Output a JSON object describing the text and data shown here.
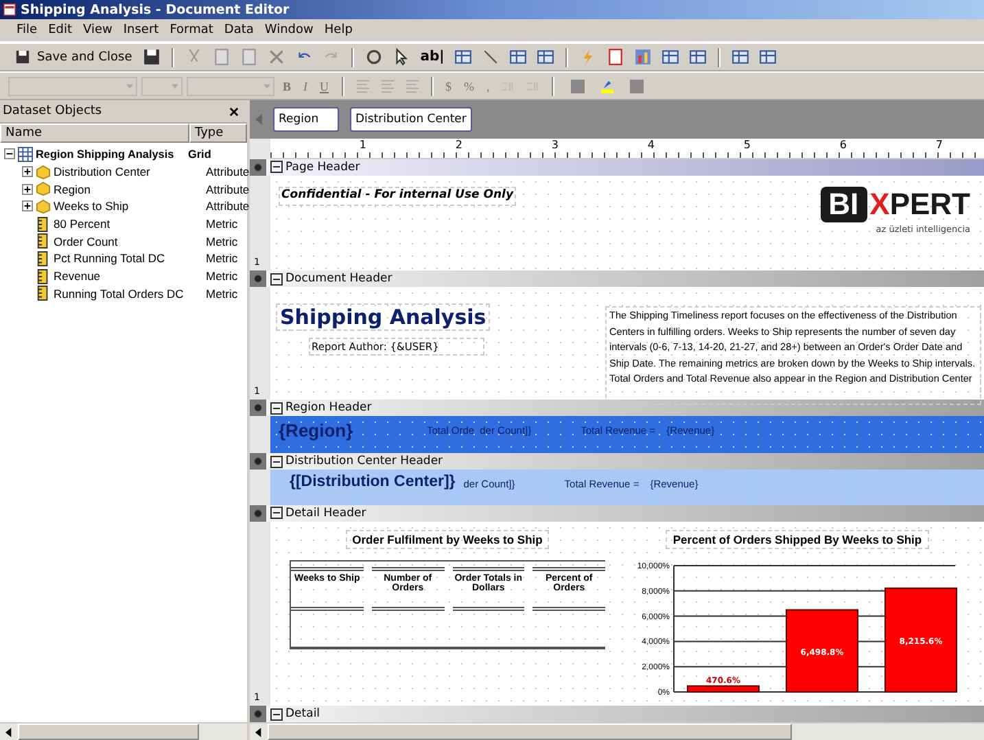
{
  "window": {
    "title": "Shipping Analysis - Document Editor"
  },
  "menu": [
    "File",
    "Edit",
    "View",
    "Insert",
    "Format",
    "Data",
    "Window",
    "Help"
  ],
  "toolbar": {
    "save_close": "Save and Close",
    "textbox_tool": "ab|",
    "font_buttons": [
      "B",
      "I",
      "U"
    ],
    "number_buttons": [
      "$",
      "%",
      ","
    ]
  },
  "dataset_panel": {
    "title": "Dataset Objects",
    "columns": [
      "Name",
      "Type"
    ],
    "items": [
      {
        "name": "Region Shipping Analysis",
        "type": "Grid",
        "kind": "grid",
        "expanded": true,
        "children": [
          {
            "name": "Distribution Center",
            "type": "Attribute",
            "kind": "attribute",
            "expanded": false
          },
          {
            "name": "Region",
            "type": "Attribute",
            "kind": "attribute",
            "expanded": false
          },
          {
            "name": "Weeks to Ship",
            "type": "Attribute",
            "kind": "attribute",
            "expanded": false
          },
          {
            "name": "80 Percent",
            "type": "Metric",
            "kind": "metric"
          },
          {
            "name": "Order Count",
            "type": "Metric",
            "kind": "metric"
          },
          {
            "name": "Pct Running Total DC",
            "type": "Metric",
            "kind": "metric"
          },
          {
            "name": "Revenue",
            "type": "Metric",
            "kind": "metric"
          },
          {
            "name": "Running Total Orders DC",
            "type": "Metric",
            "kind": "metric"
          }
        ]
      }
    ]
  },
  "page_by": [
    "Region",
    "Distribution Center"
  ],
  "ruler": [
    "1",
    "2",
    "3",
    "4",
    "5",
    "6",
    "7"
  ],
  "sections": [
    {
      "label": "Page Header",
      "kind": "page"
    },
    {
      "label": "Document Header",
      "kind": "plain"
    },
    {
      "label": "Region Header",
      "kind": "plain"
    },
    {
      "label": "Distribution Center Header",
      "kind": "plain"
    },
    {
      "label": "Detail Header",
      "kind": "plain"
    },
    {
      "label": "Detail",
      "kind": "plain"
    }
  ],
  "page_header": {
    "confidential": "Confidential - For internal Use Only",
    "logo": {
      "left": "BI",
      "accent": "X",
      "right": "PERT",
      "tagline": "az üzleti intelligencia"
    },
    "ruler_mark": "1"
  },
  "document_header": {
    "title": "Shipping Analysis",
    "author": "Report Author:  {&USER}",
    "description": "The Shipping Timeliness report focuses on the effectiveness of the Distribution Centers in fulfilling orders. Weeks to Ship represents the number of seven day intervals (0-6, 7-13, 14-20, 21-27, and 28+) between an Order's Order Date and Ship Date. The remaining metrics are broken down by the Weeks to Ship intervals. Total Orders and Total Revenue also appear in the Region and Distribution Center",
    "ruler_mark": "1"
  },
  "region_row": {
    "field": "{Region}",
    "orders_label": "Total Orde",
    "orders_value": "der Count]}",
    "revenue_label": "Total Revenue =",
    "revenue_value": "{Revenue}"
  },
  "dc_row": {
    "field": "{[Distribution Center]}",
    "orders_value": "der Count]}",
    "revenue_label": "Total Revenue =",
    "revenue_value": "{Revenue}"
  },
  "detail": {
    "table_title": "Order Fulfilment by Weeks to Ship",
    "columns": [
      "Weeks to Ship",
      "Number of Orders",
      "Order Totals in Dollars",
      "Percent of Orders"
    ],
    "ruler_mark": "1",
    "chart_title": "Percent of Orders Shipped By Weeks to Ship",
    "chart_data": {
      "type": "bar",
      "grid": true,
      "values": [
        470.6,
        6498.8,
        8215.6
      ],
      "value_labels": [
        "470.6%",
        "6,498.8%",
        "8,215.6%"
      ],
      "ylim": [
        0,
        10000
      ],
      "yticks": [
        {
          "value": 0,
          "label": "0%"
        },
        {
          "value": 2000,
          "label": "2,000%"
        },
        {
          "value": 4000,
          "label": "4,000%"
        },
        {
          "value": 6000,
          "label": "6,000%"
        },
        {
          "value": 8000,
          "label": "8,000%"
        },
        {
          "value": 10000,
          "label": "10,000%"
        }
      ]
    }
  }
}
